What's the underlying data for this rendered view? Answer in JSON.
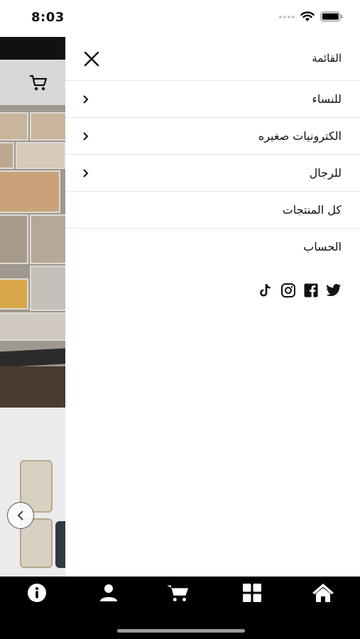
{
  "status_bar": {
    "time": "8:03"
  },
  "drawer": {
    "title": "القائمة",
    "items": [
      {
        "label": "للنساء",
        "has_submenu": true
      },
      {
        "label": "الكترونيات صغيره",
        "has_submenu": true
      },
      {
        "label": "للرجال",
        "has_submenu": true
      },
      {
        "label": "كل المنتجات",
        "has_submenu": false
      },
      {
        "label": "الحساب",
        "has_submenu": false
      }
    ],
    "socials": [
      "twitter-icon",
      "facebook-icon",
      "instagram-icon",
      "tiktok-icon"
    ]
  },
  "tabbar": {
    "tabs": [
      "info-icon",
      "account-icon",
      "cart-icon",
      "categories-icon",
      "home-icon"
    ]
  },
  "colors": {
    "drawer_bg": "#ffffff",
    "tabbar_bg": "#000000",
    "divider": "#e6e6e6"
  }
}
